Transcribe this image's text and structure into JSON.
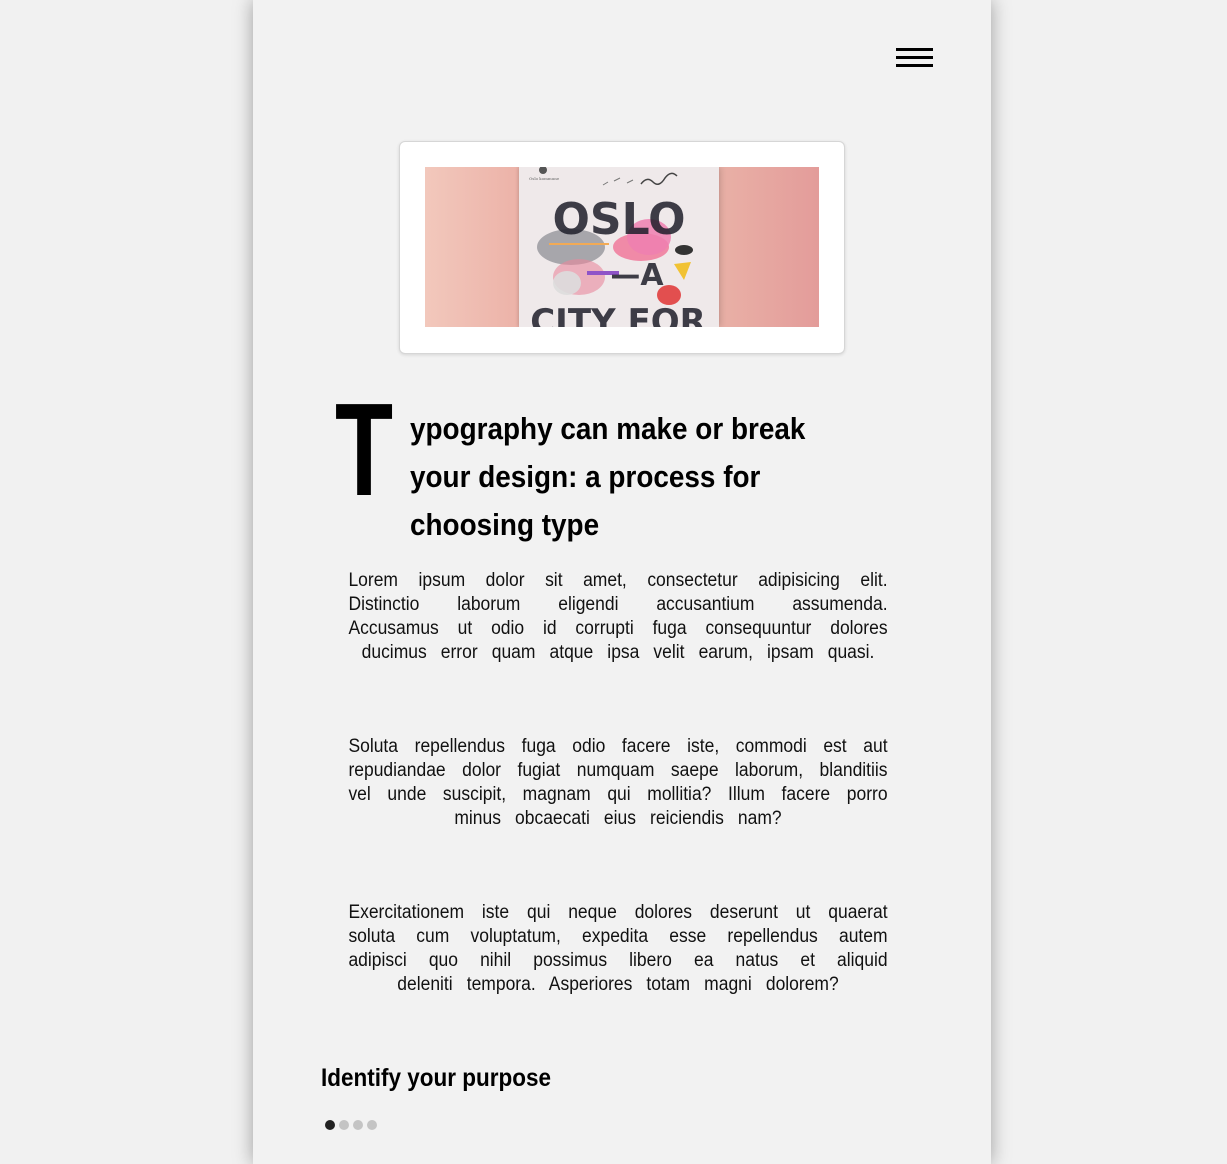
{
  "header": {
    "menu_icon": "hamburger-menu-icon"
  },
  "hero_image": {
    "alt": "Oslo - A City For poster",
    "poster_publisher": "Oslo kommune",
    "poster_lines": [
      "OSLO",
      "—A",
      "CITY FOR"
    ]
  },
  "article": {
    "drop_cap": "T",
    "title_rest": "ypography can make or break your design: a process for choosing type",
    "paragraphs": [
      "Lorem ipsum dolor sit amet, consectetur adipisicing elit. Distinctio laborum eligendi accusantium assumenda. Accusamus ut odio id corrupti fuga consequuntur dolores ducimus error quam atque ipsa velit earum, ipsam quasi.",
      "Soluta repellendus fuga odio facere iste, commodi est aut repudiandae dolor fugiat numquam saepe laborum, blanditiis vel unde suscipit, magnam qui mollitia? Illum facere porro minus obcaecati eius reiciendis nam?",
      "Exercitationem iste qui neque dolores deserunt ut quaerat soluta cum voluptatum, expedita esse repellendus autem adipisci quo nihil possimus libero ea natus et aliquid deleniti tempora. Asperiores totam magni dolorem?"
    ],
    "section_heading": "Identify your purpose"
  },
  "pagination": {
    "total": 4,
    "active_index": 0
  },
  "colors": {
    "page_bg": "#f2f2f2",
    "outer_bg": "#f1f1f1",
    "dot_active": "#222222",
    "dot_inactive": "#c4c4c4"
  }
}
